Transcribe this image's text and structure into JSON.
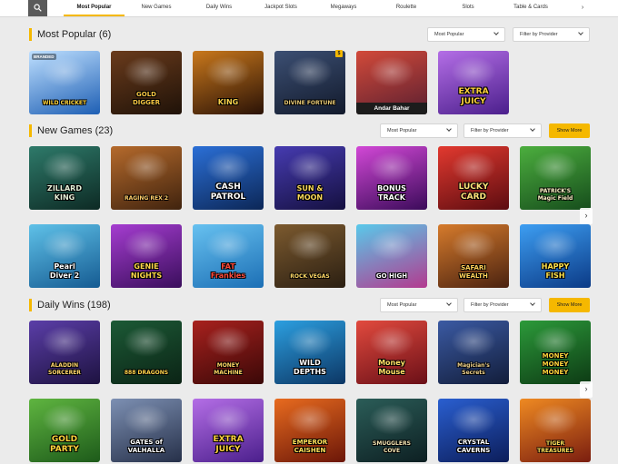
{
  "nav": {
    "tabs": [
      {
        "label": "Most Popular",
        "active": true
      },
      {
        "label": "New Games",
        "active": false
      },
      {
        "label": "Daily Wins",
        "active": false
      },
      {
        "label": "Jackpot Slots",
        "active": false
      },
      {
        "label": "Megaways",
        "active": false
      },
      {
        "label": "Roulette",
        "active": false
      },
      {
        "label": "Slots",
        "active": false
      },
      {
        "label": "Table & Cards",
        "active": false
      }
    ],
    "more_arrow": "›"
  },
  "filters": {
    "sort_value": "Most Popular",
    "provider_value": "Filter by Provider",
    "show_more_label": "Show More"
  },
  "sections": [
    {
      "title": "Most Popular (6)",
      "games": [
        {
          "name": "Big Wild Buffalo? Wild Cricket",
          "label": "WILD CRICKET",
          "bg1": "#bfe0ff",
          "bg2": "#1e5fb4",
          "color": "#ffd43b",
          "size": 6,
          "badge": "BRANDED"
        },
        {
          "name": "Gold Digger",
          "label": "GOLD\nDIGGER",
          "bg1": "#6a3b1c",
          "bg2": "#1f1208",
          "color": "#f5c542",
          "size": 7
        },
        {
          "name": "CBC King",
          "label": "KING",
          "bg1": "#c9781c",
          "bg2": "#2a1206",
          "color": "#f9d24a",
          "size": 8
        },
        {
          "name": "Divine Fortune",
          "label": "DIVINE FORTUNE",
          "bg1": "#3c4f73",
          "bg2": "#121a2c",
          "color": "#e5c774",
          "size": 6
        },
        {
          "name": "Andar Bahar",
          "label": "",
          "bg1": "#d24a3a",
          "bg2": "#5b1f30",
          "color": "#fff",
          "size": 7,
          "band": "Andar Bahar"
        },
        {
          "name": "Extra Juicy Megaways",
          "label": "EXTRA\nJUICY",
          "bg1": "#b46ee6",
          "bg2": "#4b1f8c",
          "color": "#ffd23d",
          "size": 9
        }
      ]
    },
    {
      "title": "New Games (23)",
      "games": [
        {
          "name": "Zillard King",
          "label": "ZILLARD\nKING",
          "bg1": "#2e7a6a",
          "bg2": "#0d2a24",
          "color": "#e6f0d8",
          "size": 8
        },
        {
          "name": "Raging Rex 2",
          "label": "RAGING REX 2",
          "bg1": "#b56a2c",
          "bg2": "#40230e",
          "color": "#ffcf6b",
          "size": 6
        },
        {
          "name": "Cash Patrol",
          "label": "CASH\nPATROL",
          "bg1": "#2b6fd6",
          "bg2": "#0c2757",
          "color": "#ffffff",
          "size": 9
        },
        {
          "name": "Sun & Moon",
          "label": "SUN &\nMOON",
          "bg1": "#463bb0",
          "bg2": "#151040",
          "color": "#f9d85a",
          "size": 8
        },
        {
          "name": "Bonus Track",
          "label": "BONUS\nTRACK",
          "bg1": "#d248d6",
          "bg2": "#3b0b5a",
          "color": "#ffffff",
          "size": 8
        },
        {
          "name": "Lucky Card",
          "label": "LUCKY\nCARD",
          "bg1": "#e2392f",
          "bg2": "#5c0c10",
          "color": "#ffe27a",
          "size": 9
        },
        {
          "name": "Patrick's Magic Field",
          "label": "PATRICK'S\nMagic Field",
          "bg1": "#4cae3e",
          "bg2": "#164d1c",
          "color": "#fff6c8",
          "size": 6
        },
        {
          "name": "Pearl Diver 2",
          "label": "Pearl\nDiver 2",
          "bg1": "#5fc1e8",
          "bg2": "#155b92",
          "color": "#ffffff",
          "size": 8
        },
        {
          "name": "Genie Nights",
          "label": "GENIE\nNIGHTS",
          "bg1": "#a53dd0",
          "bg2": "#3a0e5c",
          "color": "#ffd84a",
          "size": 8
        },
        {
          "name": "Fat Frankies",
          "label": "FAT\nFrankies",
          "bg1": "#67c1f0",
          "bg2": "#1c6fb5",
          "color": "#ff4a3a",
          "size": 8
        },
        {
          "name": "Rock Vegas",
          "label": "ROCK VEGAS",
          "bg1": "#7c5a2f",
          "bg2": "#2b1f12",
          "color": "#ffd966",
          "size": 6
        },
        {
          "name": "Go High",
          "label": "GO HIGH",
          "bg1": "#59c9ea",
          "bg2": "#b33a8f",
          "color": "#ffffff",
          "size": 7
        },
        {
          "name": "Safari Wealth",
          "label": "SAFARI\nWEALTH",
          "bg1": "#d67b2c",
          "bg2": "#4a2210",
          "color": "#ffd25a",
          "size": 7
        },
        {
          "name": "Happy Fish",
          "label": "HAPPY\nFISH",
          "bg1": "#3d9ef2",
          "bg2": "#0b3a86",
          "color": "#ffe14a",
          "size": 8
        }
      ]
    },
    {
      "title": "Daily Wins (198)",
      "games": [
        {
          "name": "Aladdin and the Sorcerer",
          "label": "ALADDIN\nSORCERER",
          "bg1": "#5b3ea8",
          "bg2": "#1d1240",
          "color": "#ffd66b",
          "size": 6
        },
        {
          "name": "888 Dragons",
          "label": "888 DRAGONS",
          "bg1": "#1c5a36",
          "bg2": "#0b2315",
          "color": "#ffd24a",
          "size": 6
        },
        {
          "name": "Amazing Money Machine",
          "label": "MONEY\nMACHINE",
          "bg1": "#a8211e",
          "bg2": "#3a0807",
          "color": "#ffd866",
          "size": 6
        },
        {
          "name": "Wild Depths",
          "label": "WILD\nDEPTHS",
          "bg1": "#2c9fe0",
          "bg2": "#0c3664",
          "color": "#ffffff",
          "size": 8
        },
        {
          "name": "Money Mouse",
          "label": "Money\nMouse",
          "bg1": "#e24a3e",
          "bg2": "#6a0f17",
          "color": "#ffe066",
          "size": 8
        },
        {
          "name": "Magician's Secrets",
          "label": "Magician's\nSecrets",
          "bg1": "#3b5aa3",
          "bg2": "#121d3a",
          "color": "#f1d38a",
          "size": 6
        },
        {
          "name": "Money Money Money",
          "label": "MONEY\nMONEY\nMONEY",
          "bg1": "#2c9a3a",
          "bg2": "#0d3a14",
          "color": "#ffd43b",
          "size": 7
        },
        {
          "name": "Gold Party",
          "label": "GOLD\nPARTY",
          "bg1": "#5fb540",
          "bg2": "#1d5a1a",
          "color": "#ffd43b",
          "size": 9
        },
        {
          "name": "Gates of Valhalla",
          "label": "GATES of\nVALHALLA",
          "bg1": "#7d90b3",
          "bg2": "#263049",
          "color": "#ffffff",
          "size": 7
        },
        {
          "name": "Extra Juicy Megaways",
          "label": "EXTRA\nJUICY",
          "bg1": "#b46ee6",
          "bg2": "#4b1f8c",
          "color": "#ffd23d",
          "size": 9
        },
        {
          "name": "Emperor Caishen",
          "label": "EMPEROR\nCAISHEN",
          "bg1": "#e86b1f",
          "bg2": "#6b1608",
          "color": "#ffe15a",
          "size": 7
        },
        {
          "name": "Smugglers Cove",
          "label": "SMUGGLERS\nCOVE",
          "bg1": "#2b5d58",
          "bg2": "#0d1f22",
          "color": "#f2e2b0",
          "size": 6
        },
        {
          "name": "Crystal Caverns Megaways",
          "label": "CRYSTAL\nCAVERNS",
          "bg1": "#2a5fd0",
          "bg2": "#0c1d5a",
          "color": "#ffffff",
          "size": 7
        },
        {
          "name": "Lucky New Year Tiger Treasures",
          "label": "TIGER\nTREASURES",
          "bg1": "#ef8a22",
          "bg2": "#7a1d0f",
          "color": "#ffe15a",
          "size": 6
        }
      ]
    }
  ],
  "coin_badge": "$",
  "row_scroll_arrow": "›"
}
